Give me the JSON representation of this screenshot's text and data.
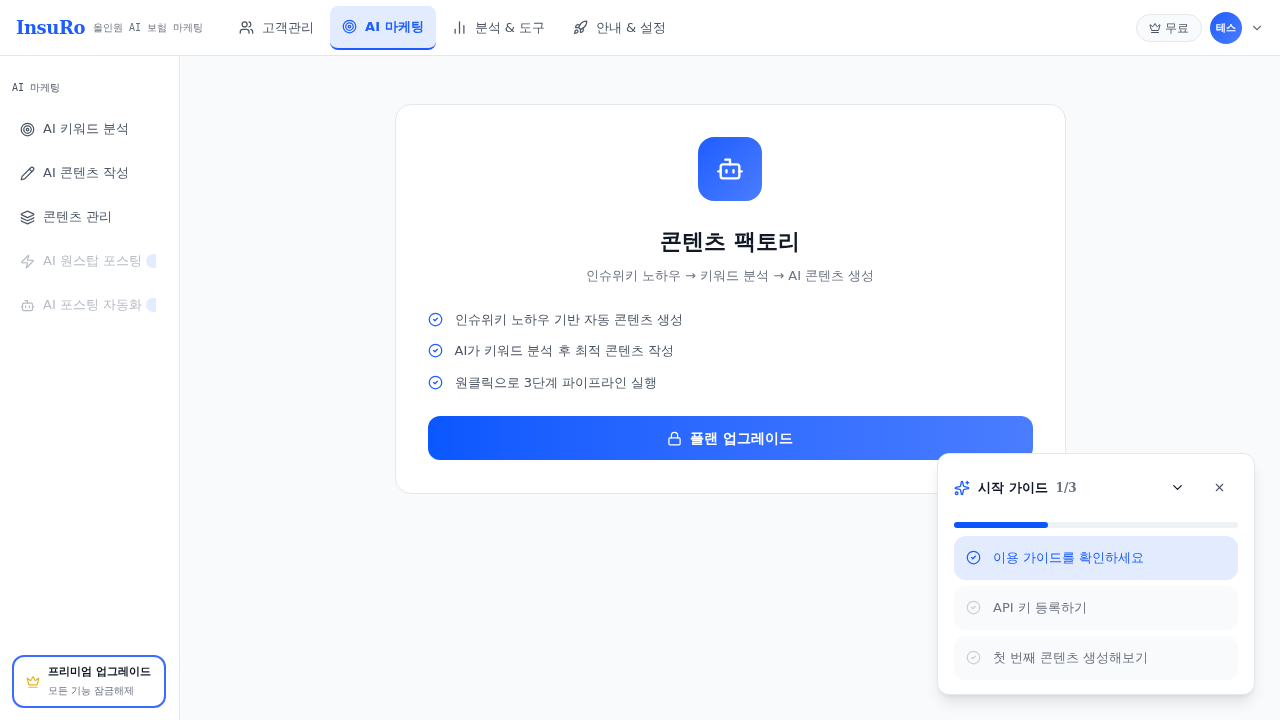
{
  "header": {
    "logo": "InsuRo",
    "tagline": "올인원 AI 보험 마케팅",
    "nav": [
      {
        "label": "고객관리",
        "selected": false
      },
      {
        "label": "AI 마케팅",
        "selected": true
      },
      {
        "label": "분석 & 도구",
        "selected": false
      },
      {
        "label": "안내 & 설정",
        "selected": false
      }
    ],
    "plan": "무료",
    "avatar": "테스"
  },
  "sidebar": {
    "section": "AI 마케팅",
    "items": [
      {
        "label": "AI 키워드 분석",
        "disabled": false,
        "badge": false
      },
      {
        "label": "AI 콘텐츠 작성",
        "disabled": false,
        "badge": false
      },
      {
        "label": "콘텐츠 관리",
        "disabled": false,
        "badge": false
      },
      {
        "label": "AI 원스탑 포스팅",
        "disabled": true,
        "badge": true
      },
      {
        "label": "AI 포스팅 자동화",
        "disabled": true,
        "badge": true
      }
    ],
    "upgrade": {
      "title": "프리미엄 업그레이드",
      "subtitle": "모든 기능 잠금해제"
    }
  },
  "card": {
    "title": "콘텐츠 팩토리",
    "subtitle": "인슈위키 노하우 → 키워드 분석 → AI 콘텐츠 생성",
    "features": [
      "인슈위키 노하우 기반 자동 콘텐츠 생성",
      "AI가 키워드 분석 후 최적 콘텐츠 작성",
      "원클릭으로 3단계 파이프라인 실행"
    ],
    "button": "플랜 업그레이드"
  },
  "guide": {
    "title": "시작 가이드",
    "step": "1/3",
    "level": 0.33,
    "items": [
      {
        "label": "이용 가이드를 확인하세요",
        "selected": true
      },
      {
        "label": "API 키 등록하기",
        "selected": false
      },
      {
        "label": "첫 번째 콘텐츠 생성해보기",
        "selected": false
      }
    ]
  }
}
